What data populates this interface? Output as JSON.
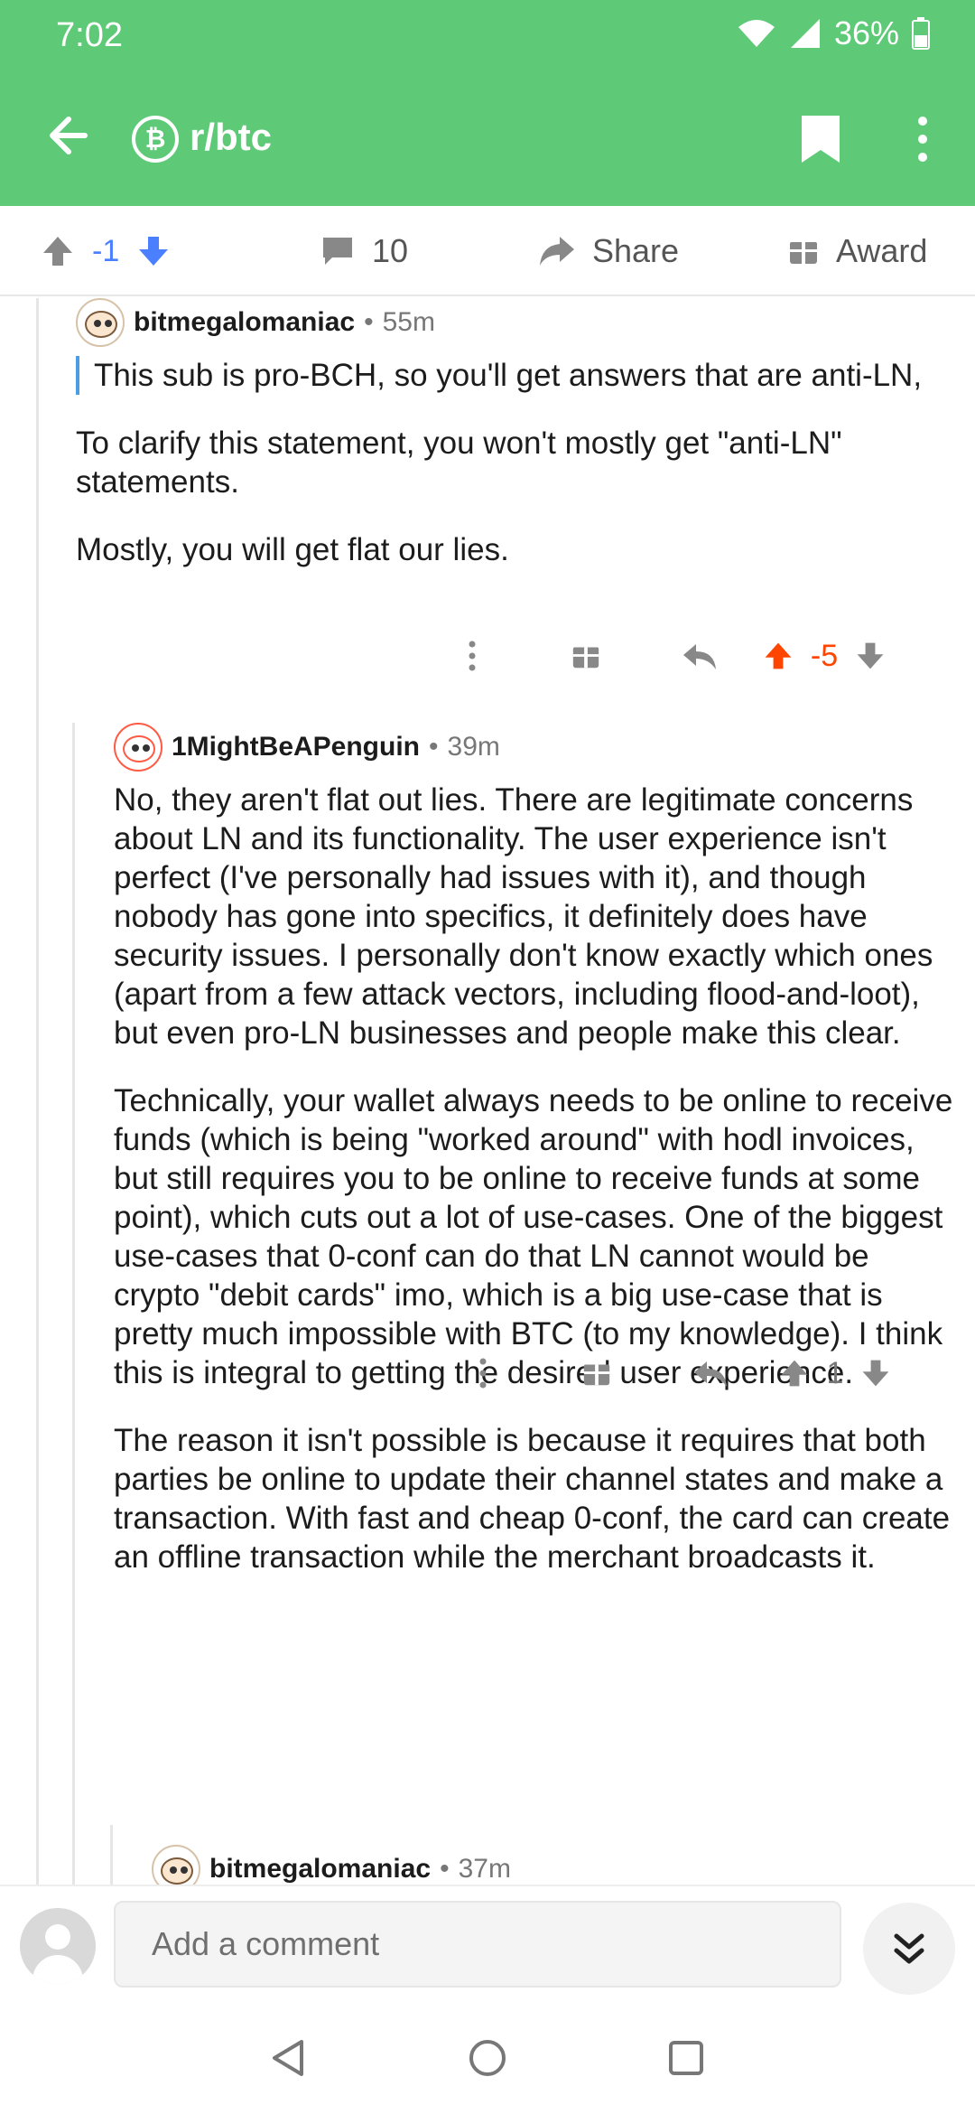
{
  "status": {
    "time": "7:02",
    "battery": "36%"
  },
  "appbar": {
    "subreddit": "r/btc",
    "sub_icon_glyph": "₿"
  },
  "post_actions": {
    "score": "-1",
    "comments": "10",
    "share": "Share",
    "award": "Award"
  },
  "comments": [
    {
      "user": "bitmegalomaniac",
      "age": "55m",
      "quote": "This sub is pro-BCH, so you'll get answers that are anti-LN,",
      "paragraphs": [
        "To clarify this statement, you won't mostly get \"anti-LN\" statements.",
        "Mostly, you will get flat our lies."
      ],
      "score": "-5",
      "upvoted": true
    },
    {
      "user": "1MightBeAPenguin",
      "age": "39m",
      "paragraphs": [
        "No, they aren't flat out lies. There are legitimate concerns about LN and its functionality. The user experience isn't perfect (I've personally had issues with it), and though nobody has gone into specifics, it definitely does have security issues. I personally don't know exactly which ones (apart from a few attack vectors, including flood-and-loot), but even pro-LN businesses and people make this clear.",
        "Technically, your wallet always needs to be online to receive funds (which is being \"worked around\" with hodl invoices, but still requires you to be online to receive funds at some point), which cuts out a lot of use-cases. One of the biggest use-cases that 0-conf can do that LN cannot would be crypto \"debit cards\" imo, which is a big use-case that is pretty much impossible with BTC (to my knowledge). I think this is integral to getting the desired user experience.",
        "The reason it isn't possible is because it requires that both parties be online to update their channel states and make a transaction. With fast and cheap 0-conf, the card can create an offline transaction while the merchant broadcasts it."
      ],
      "score": "1"
    },
    {
      "user": "bitmegalomaniac",
      "age": "37m"
    }
  ],
  "comment_bar": {
    "placeholder": "Add a comment"
  },
  "colors": {
    "brand": "#5ec977",
    "upvote": "#ff4500",
    "downvote_blue": "#4a80ff",
    "quote_bar": "#4c9ee4"
  },
  "icons": [
    "back-arrow-icon",
    "bitcoin-icon",
    "bookmark-icon",
    "more-vert-icon",
    "upvote-icon",
    "downvote-icon",
    "comment-icon",
    "share-icon",
    "award-icon",
    "reply-icon",
    "chevron-double-down-icon"
  ]
}
